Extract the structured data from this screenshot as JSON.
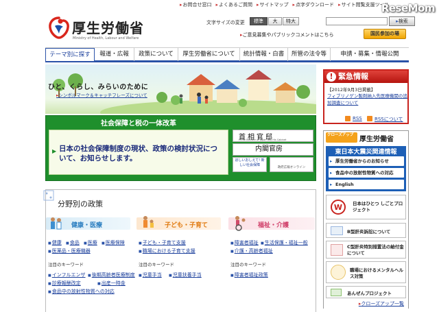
{
  "header": {
    "top_links": [
      "お問合せ窓口",
      "よくあるご質問",
      "サイトマップ",
      "点字ダウンロード",
      "サイト閲覧支援ツール"
    ],
    "watermark": "ReseMom",
    "logo_text": "厚生労働省",
    "logo_subtext": "Ministry of Health, Labour and Welfare",
    "font_size_label": "文字サイズの変更",
    "font_sizes": [
      "標準",
      "大",
      "特大"
    ],
    "search_placeholder": "",
    "search_button": "検索",
    "opinion_link": "ご意見募集やパブリックコメントはこちら",
    "kokumin_button": "国民参加の場"
  },
  "nav": {
    "items": [
      "テーマ別に探す",
      "報道・広報",
      "政策について",
      "厚生労働省について",
      "統計情報・白書",
      "所管の法令等",
      "申請・募集・情報公開"
    ]
  },
  "hero": {
    "slogan": "ひと、くらし、みらいのために",
    "link": "シンボルマーク＆キャッチフレーズについて"
  },
  "banner": {
    "title": "社会保障と税の一体改革",
    "text": "日本の社会保障制度の現状、政策の検討状況について、お知らせします。",
    "kantei_title": "首相官邸",
    "kantei_sub": "Prime Minister of Japan and His Cabinet",
    "naikaku": "内閣官房",
    "shakai_small": "ほしいおしえて! 新しい社会保障",
    "seifu_small": "政府広報オンライン"
  },
  "policy": {
    "title": "分野別の政策",
    "keyword_label": "注目のキーワード",
    "categories": [
      {
        "label": "健康・医療",
        "links": [
          "健康",
          "食品",
          "医療",
          "医療保険",
          "医薬品・医療機器"
        ],
        "keywords": [
          "インフルエンザ",
          "後期高齢者医療制度",
          "診療報酬改定",
          "出産一時金",
          "食品中の放射性物質への対応"
        ]
      },
      {
        "label": "子ども・子育て",
        "links": [
          "子ども・子育て支援",
          "職場における子育て支援"
        ],
        "keywords": [
          "児童手当",
          "児童扶養手当"
        ]
      },
      {
        "label": "福祉・介護",
        "links": [
          "障害者福祉",
          "生活保護・福祉一般",
          "介護・高齢者福祉"
        ],
        "keywords": [
          "障害者福祉政策"
        ]
      }
    ]
  },
  "emergency": {
    "title": "緊急情報",
    "date": "【2012年9月3日掲載】",
    "link": "フィブリノゲン製剤納入先医療機関の追加調査について",
    "rss1": "RSS",
    "rss2": "RSSについて"
  },
  "closeup": {
    "label": "クローズアップ",
    "title": "厚生労働省",
    "quake_title": "東日本大震災関連情報",
    "quake_links": [
      "厚生労働省からのお知らせ",
      "食品中の放射性物質への対応",
      "English"
    ],
    "banners": [
      "日本はひとつ しごとプロジェクト",
      "B型肝炎訴訟について",
      "C型肝炎特別措置法の給付金について",
      "職場におけるメンタルヘルス対策",
      "あんぜんプロジェクト"
    ],
    "more": "クローズアップ一覧"
  },
  "colors": {
    "nav_blue": "#2a52a8",
    "banner_green": "#1f8f2c",
    "emergency_red": "#c8231e",
    "quake_blue": "#1d5fb6"
  }
}
